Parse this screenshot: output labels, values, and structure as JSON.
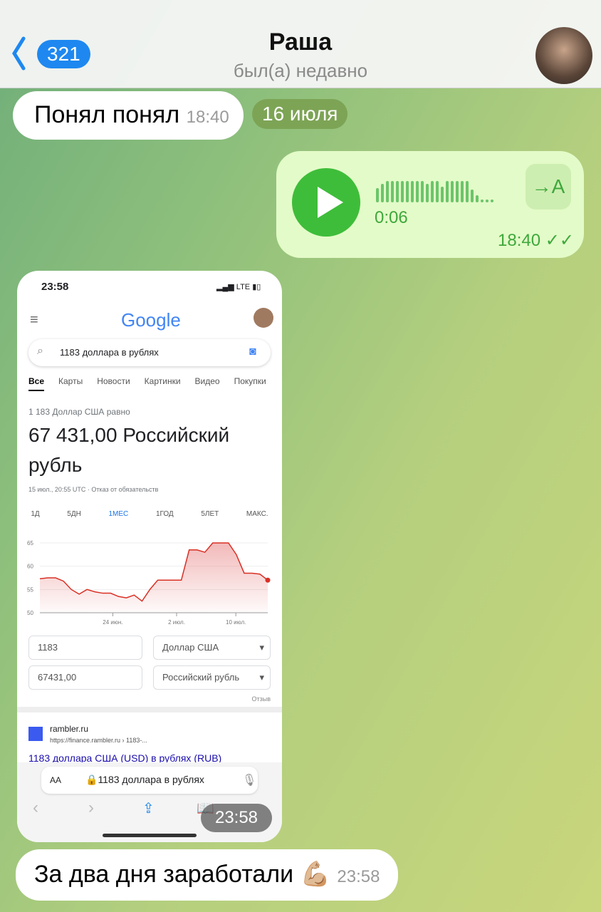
{
  "header": {
    "back_count": "321",
    "title": "Раша",
    "status": "был(а) недавно"
  },
  "messages": [
    {
      "text": "Понял понял",
      "time": "18:40"
    },
    {
      "date": "16 июля"
    },
    {
      "type": "voice",
      "duration": "0:06",
      "time": "18:40",
      "transcribe": "→A",
      "read": true
    },
    {
      "type": "image",
      "time": "23:58"
    },
    {
      "text": "За два дня заработали",
      "emoji": "💪🏼",
      "time": "23:58"
    }
  ],
  "screenshot": {
    "status_time": "23:58",
    "network": "LTE",
    "logo": "Google",
    "search": "1183 доллара в рублях",
    "tabs": [
      "Все",
      "Карты",
      "Новости",
      "Картинки",
      "Видео",
      "Покупки"
    ],
    "result_label": "1 183 Доллар США равно",
    "result_value": "67 431,00 Российский рубль",
    "result_note": "15 июл., 20:55 UTC · Отказ от обязательств",
    "ranges": [
      "1Д",
      "5ДН",
      "1МЕС",
      "1ГОД",
      "5ЛЕТ",
      "МАКС."
    ],
    "active_range": "1МЕС",
    "from_amount": "1183",
    "from_currency": "Доллар США",
    "to_amount": "67431,00",
    "to_currency": "Российский рубль",
    "feedback": "Отзыв",
    "link_site": "rambler.ru",
    "link_url": "https://finance.rambler.ru › 1183-...",
    "link_title": "1183 доллара США (USD) в рублях (RUB)",
    "address": "1183 доллара в рублях",
    "address_aa": "AA"
  },
  "chart_data": {
    "type": "area",
    "color": "#d93025",
    "yticks": [
      50,
      55,
      60,
      65
    ],
    "xticks": [
      "24 июн.",
      "2 июл.",
      "10 июл."
    ],
    "ylim": [
      50,
      65
    ],
    "values": [
      57.3,
      57.5,
      57.5,
      56.8,
      55,
      54,
      55,
      54.5,
      54.2,
      54.2,
      53.5,
      53.2,
      53.8,
      52.5,
      55,
      57,
      57,
      57,
      57,
      63.5,
      63.5,
      63,
      65,
      65,
      65,
      62.5,
      58.5,
      58.5,
      58.3,
      57
    ]
  }
}
